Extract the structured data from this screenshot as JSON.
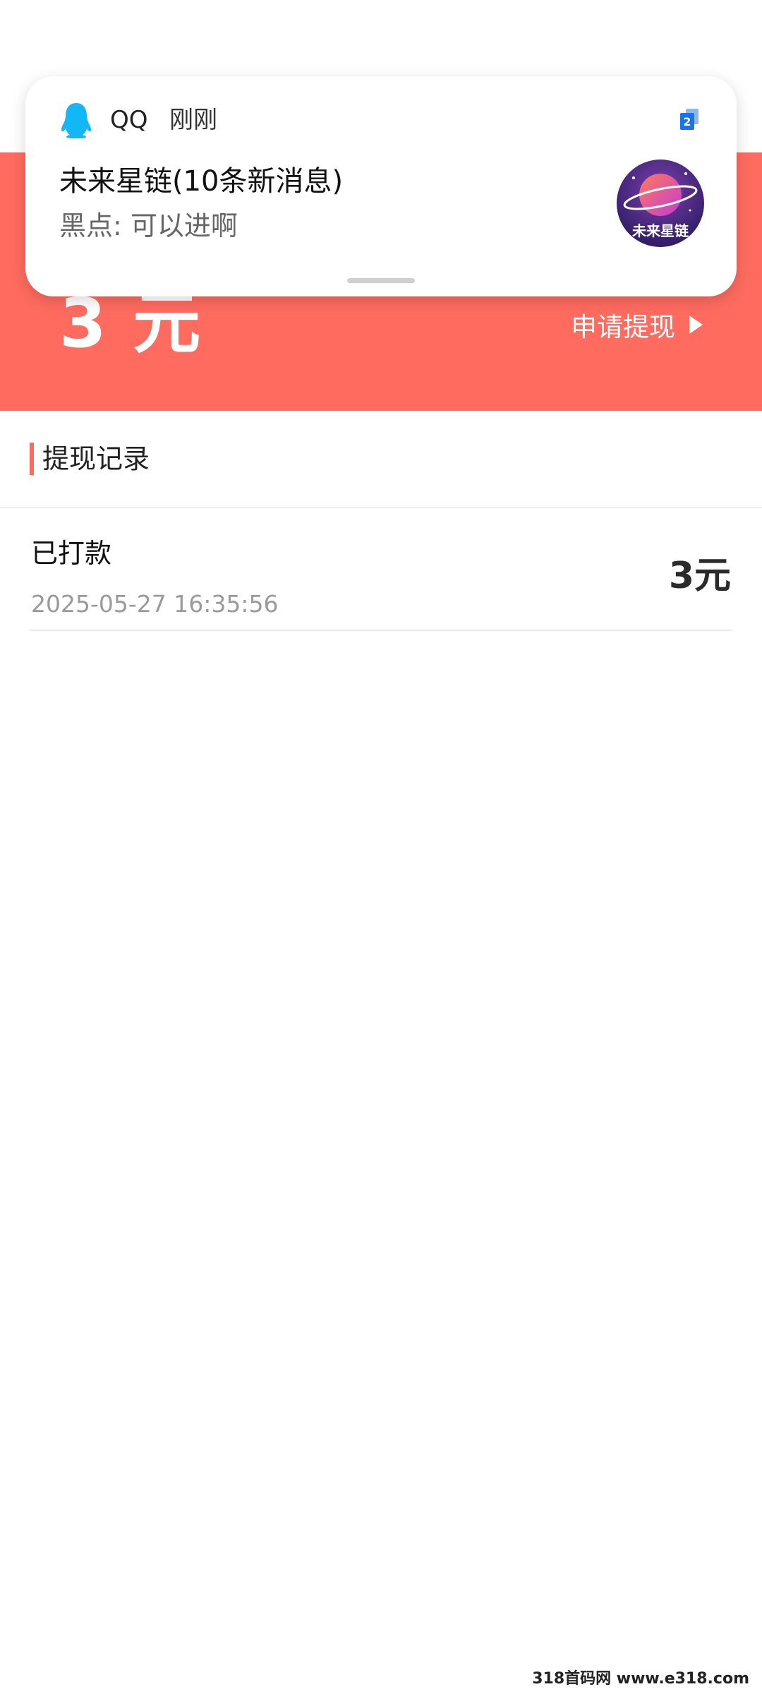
{
  "balance": {
    "amount": "3 元"
  },
  "withdraw": {
    "label": "申请提现"
  },
  "section": {
    "title": "提现记录"
  },
  "records": [
    {
      "status": "已打款",
      "time": "2025-05-27 16:35:56",
      "amount": "3元"
    }
  ],
  "notification": {
    "app": "QQ",
    "time": "刚刚",
    "badge": "2",
    "title": "未来星链(10条新消息)",
    "body": "黑点: 可以进啊",
    "avatar_text": "未来星链"
  },
  "watermark": "318首码网 www.e318.com",
  "colors": {
    "accent": "#ff6b5f",
    "qq_blue": "#12b7f5",
    "badge_blue": "#1a73e8"
  }
}
